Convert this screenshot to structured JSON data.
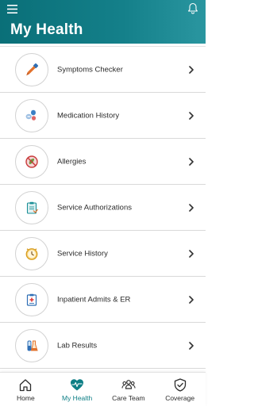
{
  "header": {
    "title": "My Health"
  },
  "menu": {
    "items": [
      {
        "label": "Symptoms Checker",
        "icon": "dropper-icon"
      },
      {
        "label": "Medication History",
        "icon": "pills-icon"
      },
      {
        "label": "Allergies",
        "icon": "no-allergen-icon"
      },
      {
        "label": "Service Authorizations",
        "icon": "clipboard-icon"
      },
      {
        "label": "Service History",
        "icon": "clock-icon"
      },
      {
        "label": "Inpatient Admits & ER",
        "icon": "medical-clipboard-icon"
      },
      {
        "label": "Lab Results",
        "icon": "lab-flask-icon"
      }
    ]
  },
  "tabbar": {
    "active": "My Health",
    "accent_color": "#0e7f86",
    "tabs": [
      {
        "label": "Home",
        "icon": "home-icon"
      },
      {
        "label": "My Health",
        "icon": "heart-pulse-icon"
      },
      {
        "label": "Care Team",
        "icon": "care-team-icon"
      },
      {
        "label": "Coverage",
        "icon": "shield-icon"
      }
    ]
  },
  "colors": {
    "header_start": "#0a6f78",
    "header_end": "#2a96a0",
    "icon_orange": "#e2712b",
    "icon_blue": "#2f6fb5",
    "icon_teal": "#1b8f96"
  }
}
